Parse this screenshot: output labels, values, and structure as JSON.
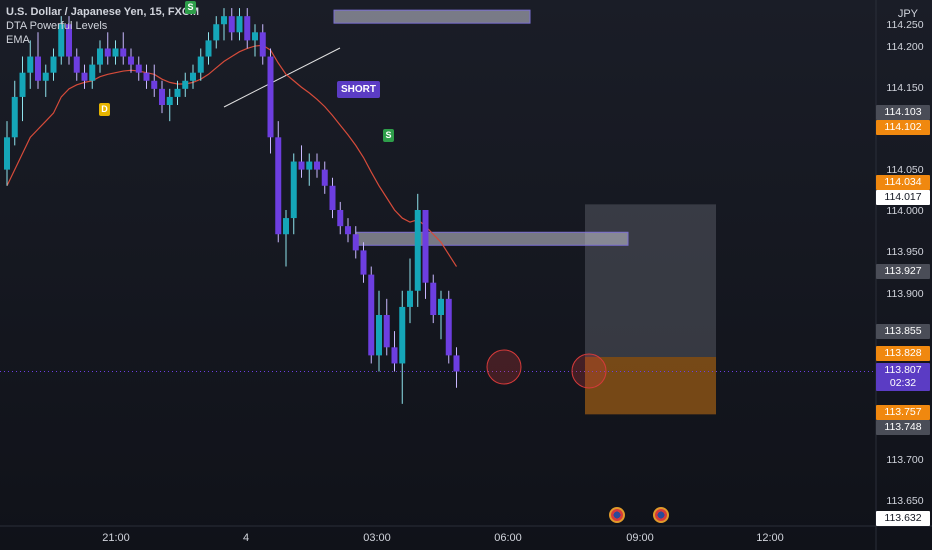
{
  "legend": {
    "symbol": "U.S. Dollar / Japanese Yen, 15, FXCM",
    "indicator1": "DTA Powerful Levels",
    "indicator2": "EMA"
  },
  "currency": "JPY",
  "price_axis": {
    "labels": [
      "114.250",
      "114.200",
      "114.150",
      "114.050",
      "114.000",
      "113.950",
      "113.900",
      "113.700",
      "113.650"
    ]
  },
  "price_tags": [
    {
      "value": "114.103",
      "style": "gray"
    },
    {
      "value": "114.102",
      "style": "orange"
    },
    {
      "value": "114.034",
      "style": "orange"
    },
    {
      "value": "114.017",
      "style": "white"
    },
    {
      "value": "113.927",
      "style": "gray"
    },
    {
      "value": "113.855",
      "style": "gray"
    },
    {
      "value": "113.828",
      "style": "orange"
    },
    {
      "value": "113.807",
      "style": "purple"
    },
    {
      "value": "02:32",
      "style": "purple"
    },
    {
      "value": "113.757",
      "style": "orange"
    },
    {
      "value": "113.748",
      "style": "gray"
    },
    {
      "value": "113.632",
      "style": "white"
    }
  ],
  "time_axis": [
    "21:00",
    "4",
    "03:00",
    "06:00",
    "09:00",
    "12:00"
  ],
  "markers": {
    "s1": "S",
    "d1": "D",
    "s2": "S",
    "short": "SHORT"
  },
  "colors": {
    "bull": "#15a6b8",
    "bear": "#6d3ee0",
    "ema": "#d64b3a",
    "orange": "#f0880f",
    "purple": "#5b3cc4"
  },
  "chart_data": {
    "type": "candlestick",
    "candles": [
      {
        "o": 114.06,
        "h": 114.12,
        "l": 114.04,
        "c": 114.1,
        "dir": "up"
      },
      {
        "o": 114.1,
        "h": 114.17,
        "l": 114.09,
        "c": 114.15,
        "dir": "up"
      },
      {
        "o": 114.15,
        "h": 114.2,
        "l": 114.12,
        "c": 114.18,
        "dir": "up"
      },
      {
        "o": 114.18,
        "h": 114.22,
        "l": 114.16,
        "c": 114.2,
        "dir": "up"
      },
      {
        "o": 114.2,
        "h": 114.23,
        "l": 114.16,
        "c": 114.17,
        "dir": "down"
      },
      {
        "o": 114.17,
        "h": 114.19,
        "l": 114.15,
        "c": 114.18,
        "dir": "up"
      },
      {
        "o": 114.18,
        "h": 114.21,
        "l": 114.17,
        "c": 114.2,
        "dir": "up"
      },
      {
        "o": 114.2,
        "h": 114.25,
        "l": 114.19,
        "c": 114.24,
        "dir": "up"
      },
      {
        "o": 114.24,
        "h": 114.25,
        "l": 114.19,
        "c": 114.2,
        "dir": "down"
      },
      {
        "o": 114.2,
        "h": 114.21,
        "l": 114.17,
        "c": 114.18,
        "dir": "down"
      },
      {
        "o": 114.18,
        "h": 114.19,
        "l": 114.16,
        "c": 114.17,
        "dir": "down"
      },
      {
        "o": 114.17,
        "h": 114.2,
        "l": 114.16,
        "c": 114.19,
        "dir": "up"
      },
      {
        "o": 114.19,
        "h": 114.22,
        "l": 114.18,
        "c": 114.21,
        "dir": "up"
      },
      {
        "o": 114.21,
        "h": 114.23,
        "l": 114.19,
        "c": 114.2,
        "dir": "down"
      },
      {
        "o": 114.2,
        "h": 114.22,
        "l": 114.19,
        "c": 114.21,
        "dir": "up"
      },
      {
        "o": 114.21,
        "h": 114.23,
        "l": 114.19,
        "c": 114.2,
        "dir": "down"
      },
      {
        "o": 114.2,
        "h": 114.21,
        "l": 114.18,
        "c": 114.19,
        "dir": "down"
      },
      {
        "o": 114.19,
        "h": 114.2,
        "l": 114.17,
        "c": 114.18,
        "dir": "down"
      },
      {
        "o": 114.18,
        "h": 114.19,
        "l": 114.16,
        "c": 114.17,
        "dir": "down"
      },
      {
        "o": 114.17,
        "h": 114.19,
        "l": 114.15,
        "c": 114.16,
        "dir": "down"
      },
      {
        "o": 114.16,
        "h": 114.17,
        "l": 114.13,
        "c": 114.14,
        "dir": "down"
      },
      {
        "o": 114.14,
        "h": 114.16,
        "l": 114.12,
        "c": 114.15,
        "dir": "up"
      },
      {
        "o": 114.15,
        "h": 114.17,
        "l": 114.14,
        "c": 114.16,
        "dir": "up"
      },
      {
        "o": 114.16,
        "h": 114.18,
        "l": 114.15,
        "c": 114.17,
        "dir": "up"
      },
      {
        "o": 114.17,
        "h": 114.19,
        "l": 114.16,
        "c": 114.18,
        "dir": "up"
      },
      {
        "o": 114.18,
        "h": 114.21,
        "l": 114.17,
        "c": 114.2,
        "dir": "up"
      },
      {
        "o": 114.2,
        "h": 114.23,
        "l": 114.19,
        "c": 114.22,
        "dir": "up"
      },
      {
        "o": 114.22,
        "h": 114.25,
        "l": 114.21,
        "c": 114.24,
        "dir": "up"
      },
      {
        "o": 114.24,
        "h": 114.26,
        "l": 114.22,
        "c": 114.25,
        "dir": "up"
      },
      {
        "o": 114.25,
        "h": 114.26,
        "l": 114.22,
        "c": 114.23,
        "dir": "down"
      },
      {
        "o": 114.23,
        "h": 114.26,
        "l": 114.22,
        "c": 114.25,
        "dir": "up"
      },
      {
        "o": 114.25,
        "h": 114.26,
        "l": 114.21,
        "c": 114.22,
        "dir": "down"
      },
      {
        "o": 114.22,
        "h": 114.24,
        "l": 114.2,
        "c": 114.23,
        "dir": "up"
      },
      {
        "o": 114.23,
        "h": 114.24,
        "l": 114.19,
        "c": 114.2,
        "dir": "down"
      },
      {
        "o": 114.2,
        "h": 114.21,
        "l": 114.08,
        "c": 114.1,
        "dir": "down"
      },
      {
        "o": 114.1,
        "h": 114.12,
        "l": 113.97,
        "c": 113.98,
        "dir": "down"
      },
      {
        "o": 113.98,
        "h": 114.01,
        "l": 113.94,
        "c": 114.0,
        "dir": "up"
      },
      {
        "o": 114.0,
        "h": 114.08,
        "l": 113.98,
        "c": 114.07,
        "dir": "up"
      },
      {
        "o": 114.07,
        "h": 114.09,
        "l": 114.05,
        "c": 114.06,
        "dir": "down"
      },
      {
        "o": 114.06,
        "h": 114.08,
        "l": 114.04,
        "c": 114.07,
        "dir": "up"
      },
      {
        "o": 114.07,
        "h": 114.08,
        "l": 114.05,
        "c": 114.06,
        "dir": "down"
      },
      {
        "o": 114.06,
        "h": 114.07,
        "l": 114.03,
        "c": 114.04,
        "dir": "down"
      },
      {
        "o": 114.04,
        "h": 114.05,
        "l": 114.0,
        "c": 114.01,
        "dir": "down"
      },
      {
        "o": 114.01,
        "h": 114.02,
        "l": 113.98,
        "c": 113.99,
        "dir": "down"
      },
      {
        "o": 113.99,
        "h": 114.0,
        "l": 113.97,
        "c": 113.98,
        "dir": "down"
      },
      {
        "o": 113.98,
        "h": 113.99,
        "l": 113.95,
        "c": 113.96,
        "dir": "down"
      },
      {
        "o": 113.96,
        "h": 113.97,
        "l": 113.92,
        "c": 113.93,
        "dir": "down"
      },
      {
        "o": 113.93,
        "h": 113.94,
        "l": 113.82,
        "c": 113.83,
        "dir": "down"
      },
      {
        "o": 113.83,
        "h": 113.91,
        "l": 113.81,
        "c": 113.88,
        "dir": "up"
      },
      {
        "o": 113.88,
        "h": 113.9,
        "l": 113.83,
        "c": 113.84,
        "dir": "down"
      },
      {
        "o": 113.84,
        "h": 113.86,
        "l": 113.81,
        "c": 113.82,
        "dir": "down"
      },
      {
        "o": 113.82,
        "h": 113.91,
        "l": 113.77,
        "c": 113.89,
        "dir": "up"
      },
      {
        "o": 113.89,
        "h": 113.95,
        "l": 113.87,
        "c": 113.91,
        "dir": "up"
      },
      {
        "o": 113.91,
        "h": 114.03,
        "l": 113.89,
        "c": 114.01,
        "dir": "up"
      },
      {
        "o": 114.01,
        "h": 114.01,
        "l": 113.9,
        "c": 113.92,
        "dir": "down"
      },
      {
        "o": 113.92,
        "h": 113.93,
        "l": 113.87,
        "c": 113.88,
        "dir": "down"
      },
      {
        "o": 113.88,
        "h": 113.91,
        "l": 113.85,
        "c": 113.9,
        "dir": "up"
      },
      {
        "o": 113.9,
        "h": 113.91,
        "l": 113.82,
        "c": 113.83,
        "dir": "down"
      },
      {
        "o": 113.83,
        "h": 113.84,
        "l": 113.79,
        "c": 113.81,
        "dir": "down"
      }
    ],
    "ema": [
      114.04,
      114.06,
      114.08,
      114.1,
      114.11,
      114.12,
      114.13,
      114.15,
      114.16,
      114.165,
      114.168,
      114.17,
      114.175,
      114.178,
      114.18,
      114.182,
      114.183,
      114.182,
      114.18,
      114.178,
      114.172,
      114.168,
      114.166,
      114.166,
      114.168,
      114.172,
      114.178,
      114.186,
      114.194,
      114.2,
      114.206,
      114.21,
      114.213,
      114.214,
      114.208,
      114.192,
      114.178,
      114.17,
      114.162,
      114.155,
      114.147,
      114.138,
      114.127,
      114.115,
      114.103,
      114.09,
      114.075,
      114.057,
      114.04,
      114.025,
      114.01,
      114.0,
      113.995,
      113.998,
      113.99,
      113.98,
      113.97,
      113.955,
      113.94
    ],
    "levels": [
      {
        "name": "top-level",
        "price": 114.25
      },
      {
        "name": "mid-level",
        "price": 113.975
      }
    ],
    "trade_box": {
      "entry": 113.828,
      "stop": 114.017,
      "target": 113.757
    },
    "y_range": [
      113.62,
      114.27
    ]
  }
}
